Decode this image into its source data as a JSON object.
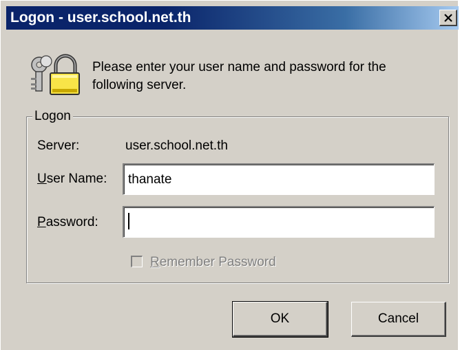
{
  "window": {
    "title": "Logon - user.school.net.th",
    "close_glyph": "✕"
  },
  "message": "Please enter your user name and password for the following server.",
  "icons": {
    "prompt": "keys-lock-icon",
    "close": "close-icon"
  },
  "logon_group": {
    "label": "Logon",
    "server_label": "Server:",
    "server_value": "user.school.net.th",
    "username_label_mnemonic": "U",
    "username_label_rest": "ser Name:",
    "username_value": "thanate",
    "password_label_mnemonic": "P",
    "password_label_rest": "assword:",
    "password_value": "",
    "remember_label_mnemonic": "R",
    "remember_label_rest": "emember Password",
    "remember_checked": false,
    "remember_enabled": false
  },
  "buttons": {
    "ok": "OK",
    "cancel": "Cancel"
  },
  "colors": {
    "title_bar_start": "#0a246a",
    "title_bar_end": "#a6caf0",
    "dialog_face": "#d4d0c8",
    "disabled_text": "#808080"
  }
}
